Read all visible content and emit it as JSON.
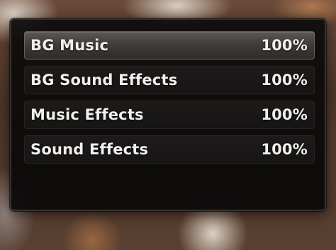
{
  "settings": {
    "items": [
      {
        "label": "BG Music",
        "value": "100%",
        "selected": true
      },
      {
        "label": "BG Sound Effects",
        "value": "100%",
        "selected": false
      },
      {
        "label": "Music Effects",
        "value": "100%",
        "selected": false
      },
      {
        "label": "Sound Effects",
        "value": "100%",
        "selected": false
      }
    ]
  }
}
